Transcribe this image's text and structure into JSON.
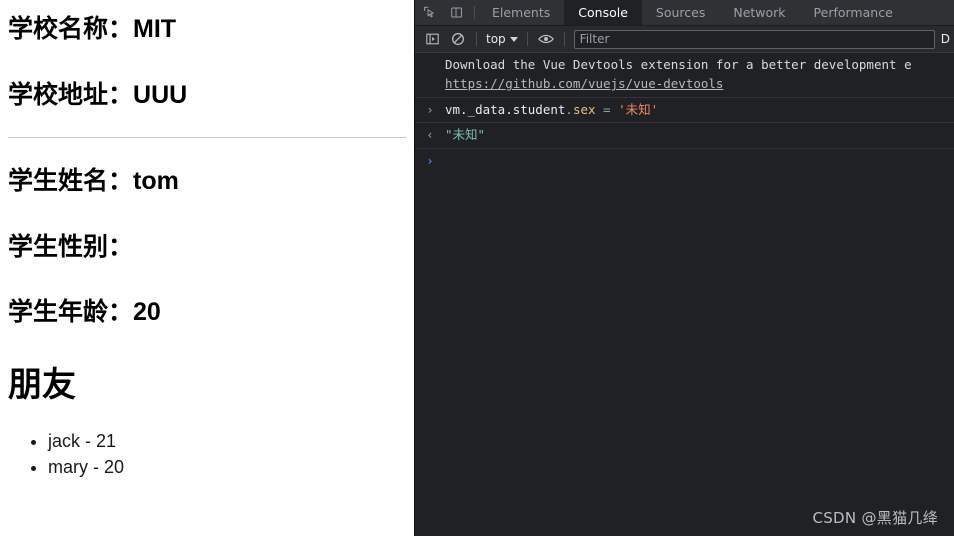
{
  "page": {
    "school": [
      {
        "label": "学校名称：",
        "value": "MIT"
      },
      {
        "label": "学校地址：",
        "value": "UUU"
      }
    ],
    "student": [
      {
        "label": "学生姓名：",
        "value": "tom"
      },
      {
        "label": "学生性别：",
        "value": ""
      },
      {
        "label": "学生年龄：",
        "value": "20"
      }
    ],
    "friends_title": "朋友",
    "friends": [
      "jack - 21",
      "mary - 20"
    ]
  },
  "devtools": {
    "icons": {
      "inspect": "inspect-element-icon",
      "device": "device-toolbar-icon",
      "sidebar": "console-sidebar-icon",
      "clear": "clear-console-icon",
      "eye": "live-expression-icon"
    },
    "tabs": [
      {
        "label": "Elements",
        "active": false
      },
      {
        "label": "Console",
        "active": true
      },
      {
        "label": "Sources",
        "active": false
      },
      {
        "label": "Network",
        "active": false
      },
      {
        "label": "Performance",
        "active": false
      }
    ],
    "toolbar": {
      "context": "top",
      "filter_placeholder": "Filter",
      "levels_label": "D"
    },
    "console": {
      "vue_message": "Download the Vue Devtools extension for a better development e",
      "vue_link": "https://github.com/vuejs/vue-devtools",
      "input_arrow": "›",
      "output_arrow": "‹",
      "prompt_arrow": "›",
      "input": {
        "expr_object": "vm._data.student",
        "expr_dot": ".",
        "expr_prop": "sex",
        "expr_eq": " = ",
        "expr_value": "'未知'"
      },
      "output_value": "\"未知\""
    },
    "watermark": "CSDN @黑猫几绛"
  },
  "colors": {
    "devtools_bg": "#202124",
    "tabbar_bg": "#2f3134",
    "accent_blue": "#4285f4",
    "string_orange": "#f28b54",
    "result_teal": "#79c0b0"
  }
}
